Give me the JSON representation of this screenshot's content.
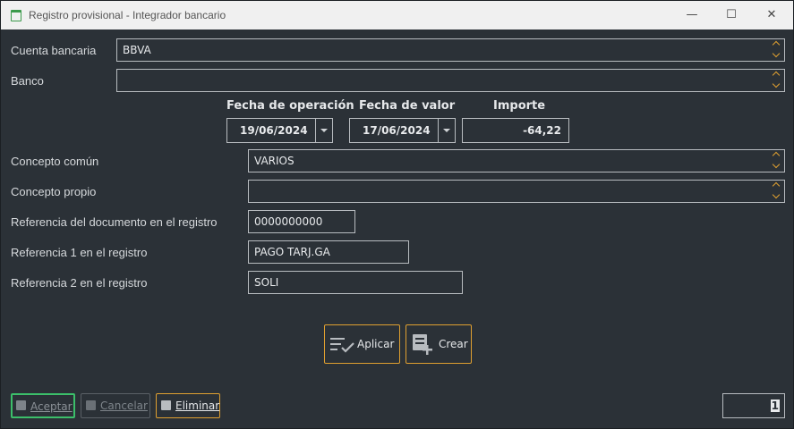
{
  "window": {
    "title": "Registro provisional - Integrador bancario",
    "minimize_glyph": "—",
    "maximize_glyph": "☐",
    "close_glyph": "✕"
  },
  "form": {
    "cuenta_bancaria": {
      "label": "Cuenta bancaria",
      "value": "BBVA"
    },
    "banco": {
      "label": "Banco",
      "value": ""
    },
    "fecha_operacion": {
      "label": "Fecha de operación",
      "value": "19/06/2024"
    },
    "fecha_valor": {
      "label": "Fecha de valor",
      "value": "17/06/2024"
    },
    "importe": {
      "label": "Importe",
      "value": "-64,22"
    },
    "concepto_comun": {
      "label": "Concepto común",
      "value": "VARIOS"
    },
    "concepto_propio": {
      "label": "Concepto propio",
      "value": ""
    },
    "ref_documento": {
      "label": "Referencia del documento en el registro",
      "value": "0000000000"
    },
    "ref1": {
      "label": "Referencia 1 en el registro",
      "value": "PAGO TARJ.GA"
    },
    "ref2": {
      "label": "Referencia 2 en el registro",
      "value": "SOLI"
    }
  },
  "actions": {
    "aplicar": "Aplicar",
    "crear": "Crear"
  },
  "footer": {
    "aceptar": "Aceptar",
    "cancelar": "Cancelar",
    "eliminar": "Eliminar",
    "page": "1"
  },
  "colors": {
    "accent": "#e0a030",
    "accept_border": "#3cbf6a",
    "background": "#2b3137"
  }
}
